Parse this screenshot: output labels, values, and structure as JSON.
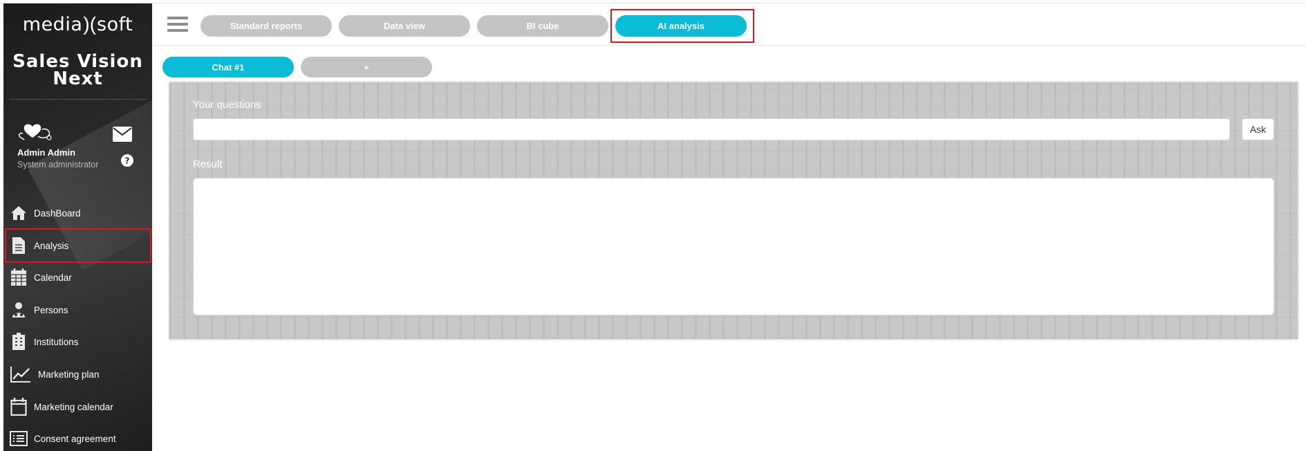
{
  "brand": {
    "logo_left": "media",
    "logo_right": "soft",
    "app_name_line1": "Sales Vision",
    "app_name_line2": "Next"
  },
  "user": {
    "name": "Admin Admin",
    "role": "System administrator"
  },
  "sidebar": {
    "items": [
      {
        "label": "DashBoard",
        "icon": "home-icon"
      },
      {
        "label": "Analysis",
        "icon": "document-icon",
        "active": true
      },
      {
        "label": "Calendar",
        "icon": "calendar-grid-icon"
      },
      {
        "label": "Persons",
        "icon": "person-icon"
      },
      {
        "label": "Institutions",
        "icon": "building-icon"
      },
      {
        "label": "Marketing plan",
        "icon": "line-chart-icon"
      },
      {
        "label": "Marketing calendar",
        "icon": "calendar-icon"
      },
      {
        "label": "Consent agreement",
        "icon": "list-icon"
      }
    ]
  },
  "top_tabs": [
    {
      "label": "Standard reports"
    },
    {
      "label": "Data view"
    },
    {
      "label": "BI cube"
    },
    {
      "label": "AI analysis",
      "active": true
    }
  ],
  "chat_tabs": [
    {
      "label": "Chat #1",
      "active": true
    },
    {
      "label": "+"
    }
  ],
  "panel": {
    "questions_label": "Your questions",
    "question_value": "",
    "ask_label": "Ask",
    "result_label": "Result",
    "result_value": ""
  },
  "colors": {
    "accent": "#0bbcd6",
    "tab_inactive": "#c4c4c4",
    "highlight": "#e0161b",
    "sidebar_bg": "#1e1e1e"
  }
}
